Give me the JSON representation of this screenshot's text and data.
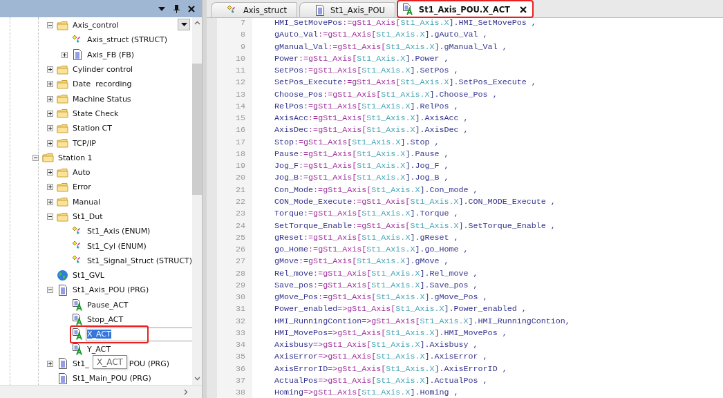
{
  "panel": {
    "tree": [
      {
        "children": [
          {
            "label": "Axis_control",
            "kind": "folder",
            "expanded": true,
            "children": [
              {
                "label": "Axis_struct (STRUCT)",
                "kind": "struct"
              },
              {
                "label": "Axis_FB (FB)",
                "kind": "pou",
                "expanded": false
              }
            ]
          },
          {
            "label": "Cylinder control",
            "kind": "folder",
            "expanded": false
          },
          {
            "label": "Date  recording",
            "kind": "folder",
            "expanded": false
          },
          {
            "label": "Machine Status",
            "kind": "folder",
            "expanded": false
          },
          {
            "label": "State Check",
            "kind": "folder",
            "expanded": false
          },
          {
            "label": "Station CT",
            "kind": "folder",
            "expanded": false
          },
          {
            "label": "TCP/IP",
            "kind": "folder",
            "expanded": false
          }
        ]
      },
      {
        "label": "Station 1",
        "kind": "folder",
        "expanded": true,
        "children": [
          {
            "label": "Auto",
            "kind": "folder",
            "expanded": false
          },
          {
            "label": "Error",
            "kind": "folder",
            "expanded": false
          },
          {
            "label": "Manual",
            "kind": "folder",
            "expanded": false
          },
          {
            "label": "St1_Dut",
            "kind": "folder",
            "expanded": true,
            "children": [
              {
                "label": "St1_Axis (ENUM)",
                "kind": "struct"
              },
              {
                "label": "St1_Cyl (ENUM)",
                "kind": "struct"
              },
              {
                "label": "St1_Signal_Struct (STRUCT)",
                "kind": "struct"
              }
            ]
          },
          {
            "label": "St1_GVL",
            "kind": "gvl"
          },
          {
            "label": "St1_Axis_POU (PRG)",
            "kind": "pou",
            "expanded": true,
            "children": [
              {
                "label": "Pause_ACT",
                "kind": "action"
              },
              {
                "label": "Stop_ACT",
                "kind": "action"
              },
              {
                "label": "X_ACT",
                "kind": "action",
                "editing": true,
                "highlighted": true
              },
              {
                "label": "Y_ACT",
                "kind": "action"
              }
            ]
          },
          {
            "label": "St1_",
            "label_tail": "POU (PRG)",
            "kind": "pou",
            "expanded": false
          },
          {
            "label": "St1_Main_POU (PRG)",
            "kind": "pou"
          }
        ]
      }
    ],
    "tooltip": "X_ACT"
  },
  "editor": {
    "tabs": [
      {
        "label": "Axis_struct",
        "kind": "struct",
        "selected": false,
        "highlighted": false
      },
      {
        "label": "St1_Axis_POU",
        "kind": "pou",
        "selected": false,
        "highlighted": false
      },
      {
        "label": "St1_Axis_POU.X_ACT",
        "kind": "action",
        "selected": true,
        "highlighted": true
      }
    ],
    "lines": [
      {
        "number": "7",
        "target": "HMI_SetMovePos",
        "op": ":=gSt1_Axis[",
        "index": "St1_Axis.X",
        "member": "].HMI_SetMovePos ,"
      },
      {
        "number": "8",
        "target": "gAuto_Val",
        "op": ":=gSt1_Axis[",
        "index": "St1_Axis.X",
        "member": "].gAuto_Val ,"
      },
      {
        "number": "9",
        "target": "gManual_Val",
        "op": ":=gSt1_Axis[",
        "index": "St1_Axis.X",
        "member": "].gManual_Val ,"
      },
      {
        "number": "10",
        "target": "Power",
        "op": ":=gSt1_Axis[",
        "index": "St1_Axis.X",
        "member": "].Power ,"
      },
      {
        "number": "11",
        "target": "SetPos",
        "op": ":=gSt1_Axis[",
        "index": "St1_Axis.X",
        "member": "].SetPos ,"
      },
      {
        "number": "12",
        "target": "SetPos_Execute",
        "op": ":=gSt1_Axis[",
        "index": "St1_Axis.X",
        "member": "].SetPos_Execute ,"
      },
      {
        "number": "13",
        "target": "Choose_Pos",
        "op": ":=gSt1_Axis[",
        "index": "St1_Axis.X",
        "member": "].Choose_Pos ,"
      },
      {
        "number": "14",
        "target": "RelPos",
        "op": ":=gSt1_Axis[",
        "index": "St1_Axis.X",
        "member": "].RelPos ,"
      },
      {
        "number": "15",
        "target": "AxisAcc",
        "op": ":=gSt1_Axis[",
        "index": "St1_Axis.X",
        "member": "].AxisAcc ,"
      },
      {
        "number": "16",
        "target": "AxisDec",
        "op": ":=gSt1_Axis[",
        "index": "St1_Axis.X",
        "member": "].AxisDec ,"
      },
      {
        "number": "17",
        "target": "Stop",
        "op": ":=gSt1_Axis[",
        "index": "St1_Axis.X",
        "member": "].Stop ,"
      },
      {
        "number": "18",
        "target": "Pause",
        "op": ":=gSt1_Axis[",
        "index": "St1_Axis.X",
        "member": "].Pause ,"
      },
      {
        "number": "19",
        "target": "Jog_F",
        "op": ":=gSt1_Axis[",
        "index": "St1_Axis.X",
        "member": "].Jog_F ,"
      },
      {
        "number": "20",
        "target": "Jog_B",
        "op": ":=gSt1_Axis[",
        "index": "St1_Axis.X",
        "member": "].Jog_B ,"
      },
      {
        "number": "21",
        "target": "Con_Mode",
        "op": ":=gSt1_Axis[",
        "index": "St1_Axis.X",
        "member": "].Con_mode ,"
      },
      {
        "number": "22",
        "target": "CON_Mode_Execute",
        "op": ":=gSt1_Axis[",
        "index": "St1_Axis.X",
        "member": "].CON_MODE_Execute ,"
      },
      {
        "number": "23",
        "target": "Torque",
        "op": ":=gSt1_Axis[",
        "index": "St1_Axis.X",
        "member": "].Torque ,"
      },
      {
        "number": "24",
        "target": "SetTorque_Enable",
        "op": ":=gSt1_Axis[",
        "index": "St1_Axis.X",
        "member": "].SetTorque_Enable ,"
      },
      {
        "number": "25",
        "target": "gReset",
        "op": ":=gSt1_Axis[",
        "index": "St1_Axis.X",
        "member": "].gReset ,"
      },
      {
        "number": "26",
        "target": "go_Home",
        "op": ":=gSt1_Axis[",
        "index": "St1_Axis.X",
        "member": "].go_Home ,"
      },
      {
        "number": "27",
        "target": "gMove",
        "op": ":=gSt1_Axis[",
        "index": "St1_Axis.X",
        "member": "].gMove ,"
      },
      {
        "number": "28",
        "target": "Rel_move",
        "op": ":=gSt1_Axis[",
        "index": "St1_Axis.X",
        "member": "].Rel_move ,"
      },
      {
        "number": "29",
        "target": "Save_pos",
        "op": ":=gSt1_Axis[",
        "index": "St1_Axis.X",
        "member": "].Save_pos ,"
      },
      {
        "number": "30",
        "target": "gMove_Pos",
        "op": ":=gSt1_Axis[",
        "index": "St1_Axis.X",
        "member": "].gMove_Pos ,"
      },
      {
        "number": "31",
        "target": "Power_enabled",
        "op": "=>gSt1_Axis[",
        "index": "St1_Axis.X",
        "member": "].Power_enabled ,"
      },
      {
        "number": "32",
        "target": "HMI_RunningContion",
        "op": "=>gSt1_Axis[",
        "index": "St1_Axis.X",
        "member": "].HMI_RunningContion,"
      },
      {
        "number": "33",
        "target": "HMI_MovePos",
        "op": "=>gSt1_Axis[",
        "index": "St1_Axis.X",
        "member": "].HMI_MovePos ,"
      },
      {
        "number": "34",
        "target": "Axisbusy",
        "op": "=>gSt1_Axis[",
        "index": "St1_Axis.X",
        "member": "].Axisbusy ,"
      },
      {
        "number": "35",
        "target": "AxisError",
        "op": "=>gSt1_Axis[",
        "index": "St1_Axis.X",
        "member": "].AxisError ,"
      },
      {
        "number": "36",
        "target": "AxisErrorID",
        "op": "=>gSt1_Axis[",
        "index": "St1_Axis.X",
        "member": "].AxisErrorID ,"
      },
      {
        "number": "37",
        "target": "ActualPos",
        "op": "=>gSt1_Axis[",
        "index": "St1_Axis.X",
        "member": "].ActualPos ,"
      },
      {
        "number": "38",
        "target": "Homing",
        "op": "=>gSt1_Axis[",
        "index": "St1_Axis.X",
        "member": "].Homing ,"
      }
    ]
  }
}
